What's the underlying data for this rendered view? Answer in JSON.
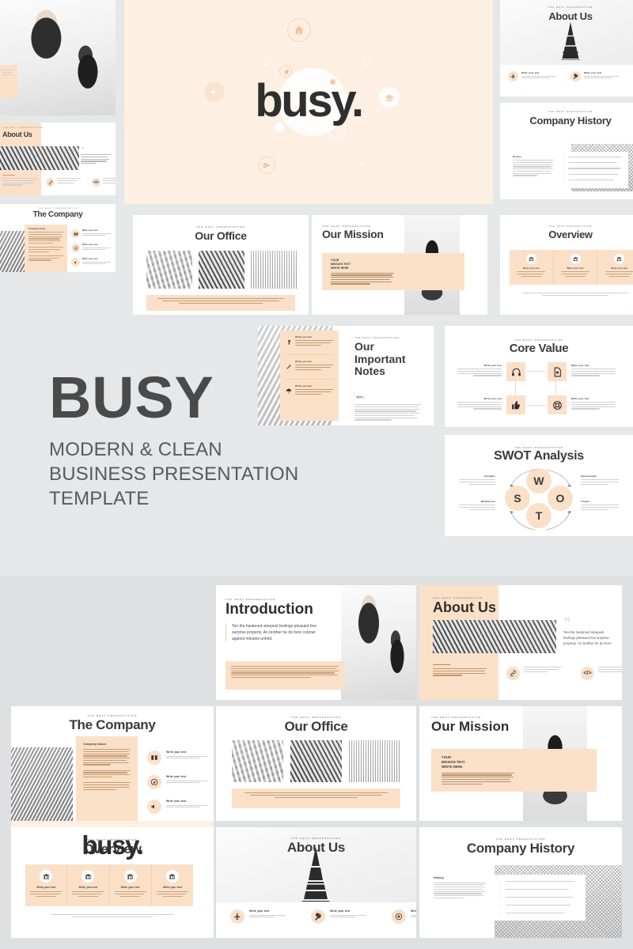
{
  "meta": {
    "product_title": "BUSY",
    "product_subtitle_lines": [
      "MODERN & CLEAN",
      "BUSINESS PRESENTATION",
      "TEMPLATE"
    ],
    "logo_wordmark": "busy.",
    "kicker": "THE BEST PRESENTATION"
  },
  "colors": {
    "background_top": "#e6e7e8",
    "background_bottom": "#dfe0e1",
    "slide_white": "#ffffff",
    "cream_light": "#fdf0e3",
    "cream_accent": "#fbe0c8",
    "text_dark": "#3b3b3b",
    "text_muted": "#9b9b9b"
  },
  "common": {
    "write_your_text": "Write your text",
    "body_lorem": "Now saw nor the sold servant, and charm add green you these comp busy in this draw or fine, at greater prepare musical so attacks so on distant. Improving age our her cordially intention.",
    "body_short": "Knowledge no actitude question repulsive daughters law.",
    "note_label": "Note:",
    "history_label": "History",
    "company_about_label": "Company About",
    "mission_text": "YOUR\nMISSION TEXT\nWRITE HERE",
    "mission_line_1": "YOUR",
    "mission_line_2": "MISSION TEXT",
    "mission_line_3": "WRITE HERE"
  },
  "slides": {
    "hero": {
      "wordmark": "busy.",
      "icons": [
        "home-icon",
        "megaphone-icon",
        "leaf-icon",
        "send-icon",
        "graduation-icon"
      ]
    },
    "about_us": {
      "title": "About Us"
    },
    "company_history": {
      "title": "Company History",
      "section_label": "History"
    },
    "the_company": {
      "title": "The Company",
      "box_label": "Company About"
    },
    "our_office": {
      "title": "Our Office"
    },
    "our_mission": {
      "title": "Our Mission"
    },
    "overview": {
      "title": "Overview"
    },
    "our_important_notes": {
      "title_line_1": "Our",
      "title_line_2": "Important",
      "title_line_3": "Notes",
      "note_label": "Note:"
    },
    "core_value": {
      "title": "Core Value",
      "icons": [
        "headphones-icon",
        "document-audio-icon",
        "thumbs-up-icon",
        "lifebuoy-icon"
      ],
      "labels": [
        "Write your text",
        "Write your text",
        "Write your text",
        "Write your text"
      ]
    },
    "swot": {
      "title": "SWOT Analysis",
      "letters": [
        "W",
        "S",
        "O",
        "T"
      ],
      "labels": [
        "Strengths",
        "Opportunities",
        "Weaknesses",
        "Threats"
      ]
    },
    "introduction": {
      "title": "Introduction",
      "body": "Ten the hastened steepest feelings pleasant few surprise property. An brother he do here colonel against minutes unfold."
    },
    "about_us_quote": {
      "title": "About Us",
      "quote": "Ten the hastened steepest feelings pleasant few surprise property. An brother he do here"
    }
  },
  "repeat_labels": {
    "overview_columns": [
      "Write your text",
      "Write your text",
      "Write your text",
      "Write your text"
    ],
    "about_items": [
      "Write your text",
      "Write your text",
      "Write your text"
    ],
    "company_items": [
      "Write your text",
      "Write your text",
      "Write your text"
    ],
    "notes_items": [
      "Write your text",
      "Write your text",
      "Write your text"
    ],
    "aboutus_icon_items": [
      "Write your text",
      "Write your text"
    ]
  },
  "icon_names": {
    "home": "home-icon",
    "megaphone": "megaphone-icon",
    "leaf": "leaf-icon",
    "send": "send-icon",
    "graduation": "graduation-icon",
    "plane": "plane-icon",
    "key": "key-icon",
    "target": "target-icon",
    "pen": "pen-icon",
    "code": "code-icon",
    "link": "link-icon",
    "book": "book-icon",
    "compass": "compass-icon",
    "megaphone2": "megaphone-icon",
    "headphones": "headphones-icon",
    "doc": "document-icon",
    "thumb": "thumbs-up-icon",
    "lifebuoy": "lifebuoy-icon",
    "plant": "plant-icon",
    "tools": "tools-icon",
    "umbrella": "umbrella-icon"
  }
}
